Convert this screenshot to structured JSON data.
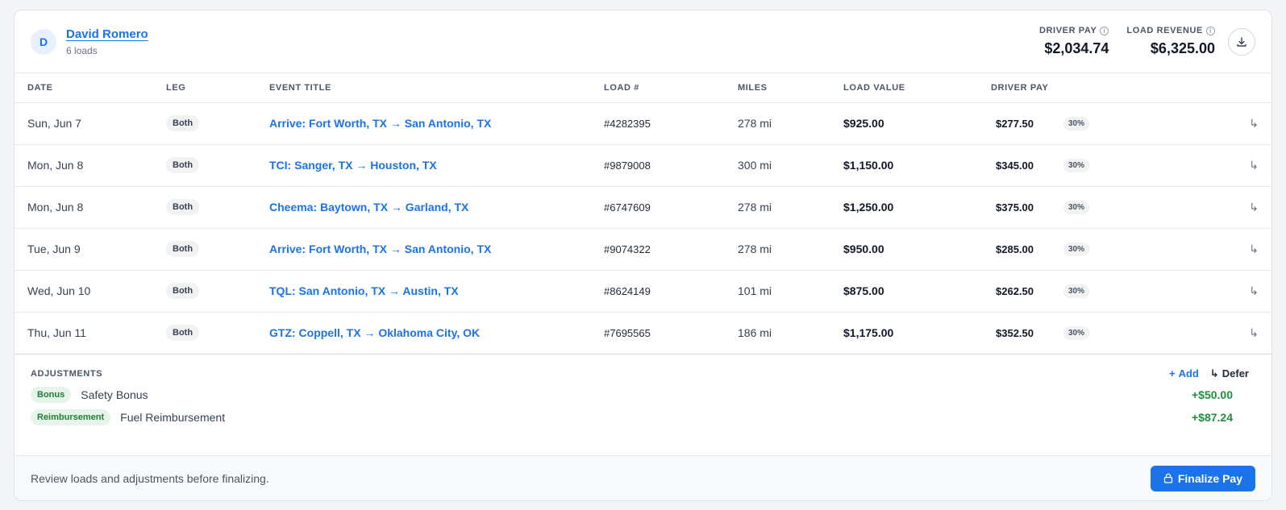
{
  "driver": {
    "initial": "D",
    "name": "David Romero",
    "load_count": "6 loads"
  },
  "stats": {
    "driver_pay_label": "DRIVER PAY",
    "driver_pay_value": "$2,034.74",
    "load_revenue_label": "LOAD REVENUE",
    "load_revenue_value": "$6,325.00"
  },
  "table": {
    "headers": [
      "DATE",
      "LEG",
      "EVENT TITLE",
      "LOAD #",
      "MILES",
      "LOAD VALUE",
      "DRIVER PAY"
    ],
    "rows": [
      {
        "date": "Sun, Jun 7",
        "leg": "Both",
        "event": "Arrive: Fort Worth, TX → San Antonio, TX",
        "load": "#4282395",
        "miles": "278 mi",
        "value": "$925.00",
        "pay": "$277.50",
        "pct": "30%"
      },
      {
        "date": "Mon, Jun 8",
        "leg": "Both",
        "event": "TCI: Sanger, TX → Houston, TX",
        "load": "#9879008",
        "miles": "300 mi",
        "value": "$1,150.00",
        "pay": "$345.00",
        "pct": "30%"
      },
      {
        "date": "Mon, Jun 8",
        "leg": "Both",
        "event": "Cheema: Baytown, TX → Garland, TX",
        "load": "#6747609",
        "miles": "278 mi",
        "value": "$1,250.00",
        "pay": "$375.00",
        "pct": "30%"
      },
      {
        "date": "Tue, Jun 9",
        "leg": "Both",
        "event": "Arrive: Fort Worth, TX → San Antonio, TX",
        "load": "#9074322",
        "miles": "278 mi",
        "value": "$950.00",
        "pay": "$285.00",
        "pct": "30%"
      },
      {
        "date": "Wed, Jun 10",
        "leg": "Both",
        "event": "TQL: San Antonio, TX → Austin, TX",
        "load": "#8624149",
        "miles": "101 mi",
        "value": "$875.00",
        "pay": "$262.50",
        "pct": "30%"
      },
      {
        "date": "Thu, Jun 11",
        "leg": "Both",
        "event": "GTZ: Coppell, TX → Oklahoma City, OK",
        "load": "#7695565",
        "miles": "186 mi",
        "value": "$1,175.00",
        "pay": "$352.50",
        "pct": "30%"
      }
    ]
  },
  "adjustments": {
    "title": "ADJUSTMENTS",
    "add_label": "Add",
    "defer_label": "Defer",
    "items": [
      {
        "type": "Bonus",
        "description": "Safety Bonus",
        "amount": "+$50.00"
      },
      {
        "type": "Reimbursement",
        "description": "Fuel Reimbursement",
        "amount": "+$87.24"
      }
    ]
  },
  "footer": {
    "note": "Review loads and adjustments before finalizing.",
    "finalize_label": "Finalize Pay"
  },
  "icons": {
    "info": "info-icon",
    "download": "download-icon",
    "defer_arrow": "return-arrow-icon",
    "plus": "plus-icon",
    "lock": "lock-icon"
  },
  "colors": {
    "accent": "#1a73e8",
    "positive": "#1e8e3e",
    "badge_green_bg": "#e6f4ea"
  }
}
